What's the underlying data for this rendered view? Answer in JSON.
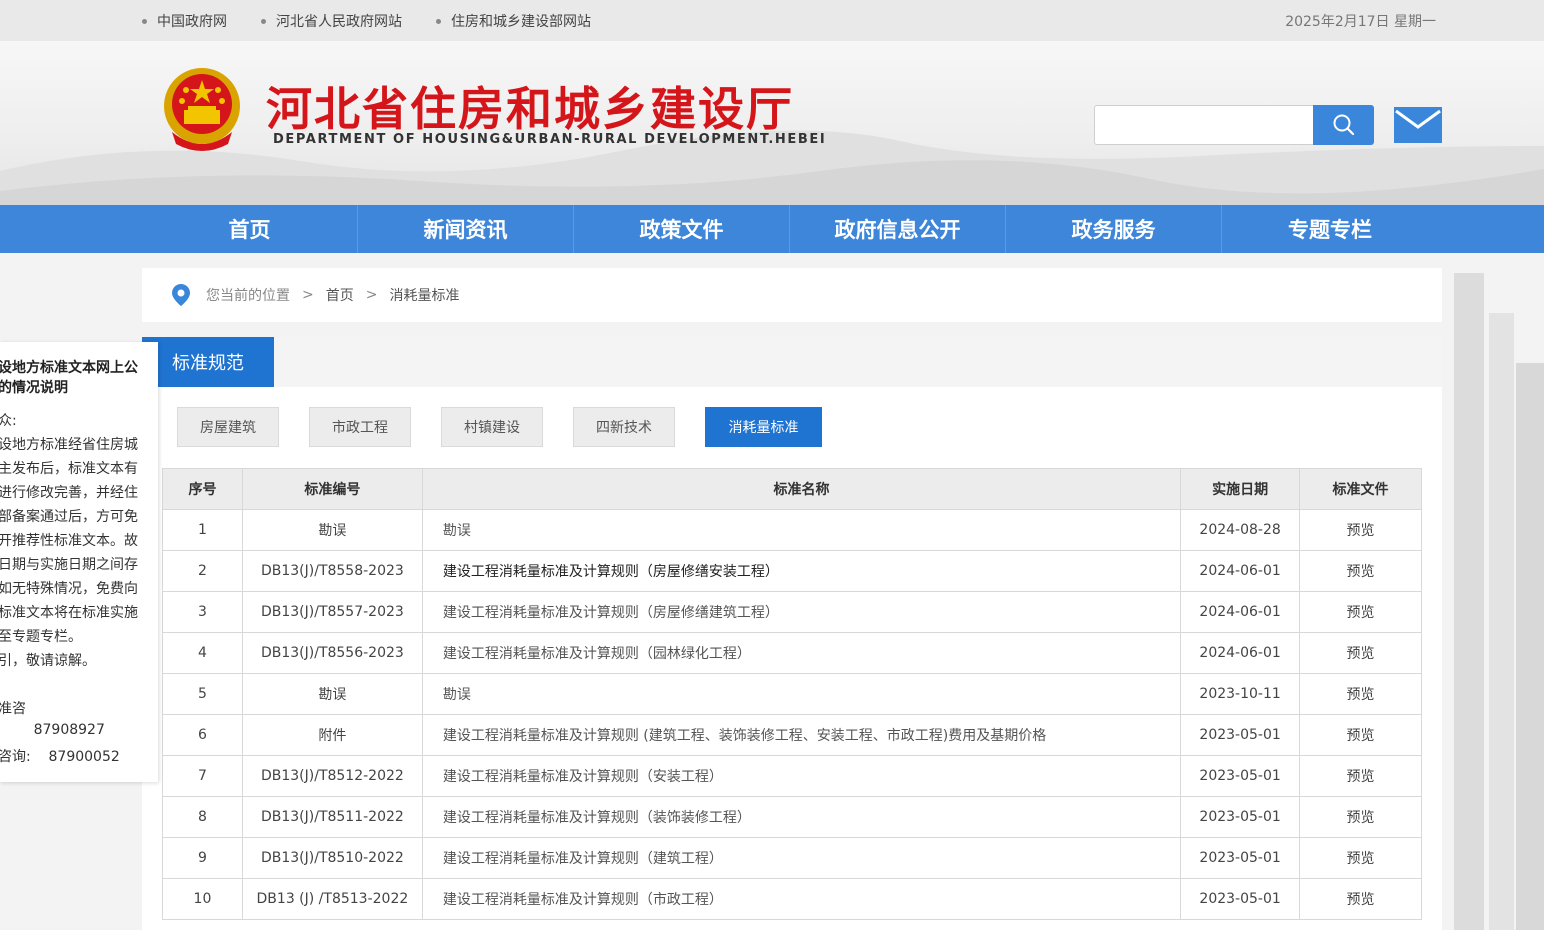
{
  "topbar": {
    "links": [
      "中国政府网",
      "河北省人民政府网站",
      "住房和城乡建设部网站"
    ],
    "date": "2025年2月17日 星期一"
  },
  "header": {
    "title": "河北省住房和城乡建设厅",
    "subtitle": "DEPARTMENT OF HOUSING&URBAN-RURAL DEVELOPMENT.HEBEI",
    "search_placeholder": ""
  },
  "nav": {
    "items": [
      "首页",
      "新闻资讯",
      "政策文件",
      "政府信息公开",
      "政务服务",
      "专题专栏"
    ]
  },
  "breadcrumb": {
    "label": "您当前的位置",
    "sep": ">",
    "home": "首页",
    "current": "消耗量标准"
  },
  "section": {
    "title": "标准规范",
    "tabs": [
      "房屋建筑",
      "市政工程",
      "村镇建设",
      "四新技术",
      "消耗量标准"
    ],
    "active_tab": "消耗量标准"
  },
  "table": {
    "headers": [
      "序号",
      "标准编号",
      "标准名称",
      "实施日期",
      "标准文件"
    ],
    "rows": [
      [
        "1",
        "勘误",
        "勘误",
        "2024-08-28",
        "预览"
      ],
      [
        "2",
        "DB13(J)/T8558-2023",
        "建设工程消耗量标准及计算规则（房屋修缮安装工程）",
        "2024-06-01",
        "预览"
      ],
      [
        "3",
        "DB13(J)/T8557-2023",
        "建设工程消耗量标准及计算规则（房屋修缮建筑工程）",
        "2024-06-01",
        "预览"
      ],
      [
        "4",
        "DB13(J)/T8556-2023",
        "建设工程消耗量标准及计算规则（园林绿化工程）",
        "2024-06-01",
        "预览"
      ],
      [
        "5",
        "勘误",
        "勘误",
        "2023-10-11",
        "预览"
      ],
      [
        "6",
        "附件",
        "建设工程消耗量标准及计算规则 (建筑工程、装饰装修工程、安装工程、市政工程)费用及基期价格",
        "2023-05-01",
        "预览"
      ],
      [
        "7",
        "DB13(J)/T8512-2022",
        "建设工程消耗量标准及计算规则（安装工程）",
        "2023-05-01",
        "预览"
      ],
      [
        "8",
        "DB13(J)/T8511-2022",
        "建设工程消耗量标准及计算规则（装饰装修工程）",
        "2023-05-01",
        "预览"
      ],
      [
        "9",
        "DB13(J)/T8510-2022",
        "建设工程消耗量标准及计算规则（建筑工程）",
        "2023-05-01",
        "预览"
      ],
      [
        "10",
        "DB13 (J) /T8513-2022",
        "建设工程消耗量标准及计算规则（市政工程）",
        "2023-05-01",
        "预览"
      ]
    ]
  },
  "notice": {
    "title_lines": [
      "设地方标准文本网上公",
      "的情况说明"
    ],
    "lines": [
      "众:",
      "设地方标准经省住房城",
      "主发布后，标准文本有",
      "进行修改完善，并经住",
      "部备案通过后，方可免",
      "开推荐性标准文本。故",
      "日期与实施日期之间存",
      "如无特殊情况，免费向",
      "标准文本将在标准实施",
      "至专题专栏。",
      "引，敬请谅解。",
      "",
      "准咨",
      "        87908927",
      "咨询:    87900052"
    ]
  },
  "colors": {
    "brand_red": "#d4161b",
    "nav_blue": "#3e86d9",
    "accent_blue": "#1f73d1"
  }
}
